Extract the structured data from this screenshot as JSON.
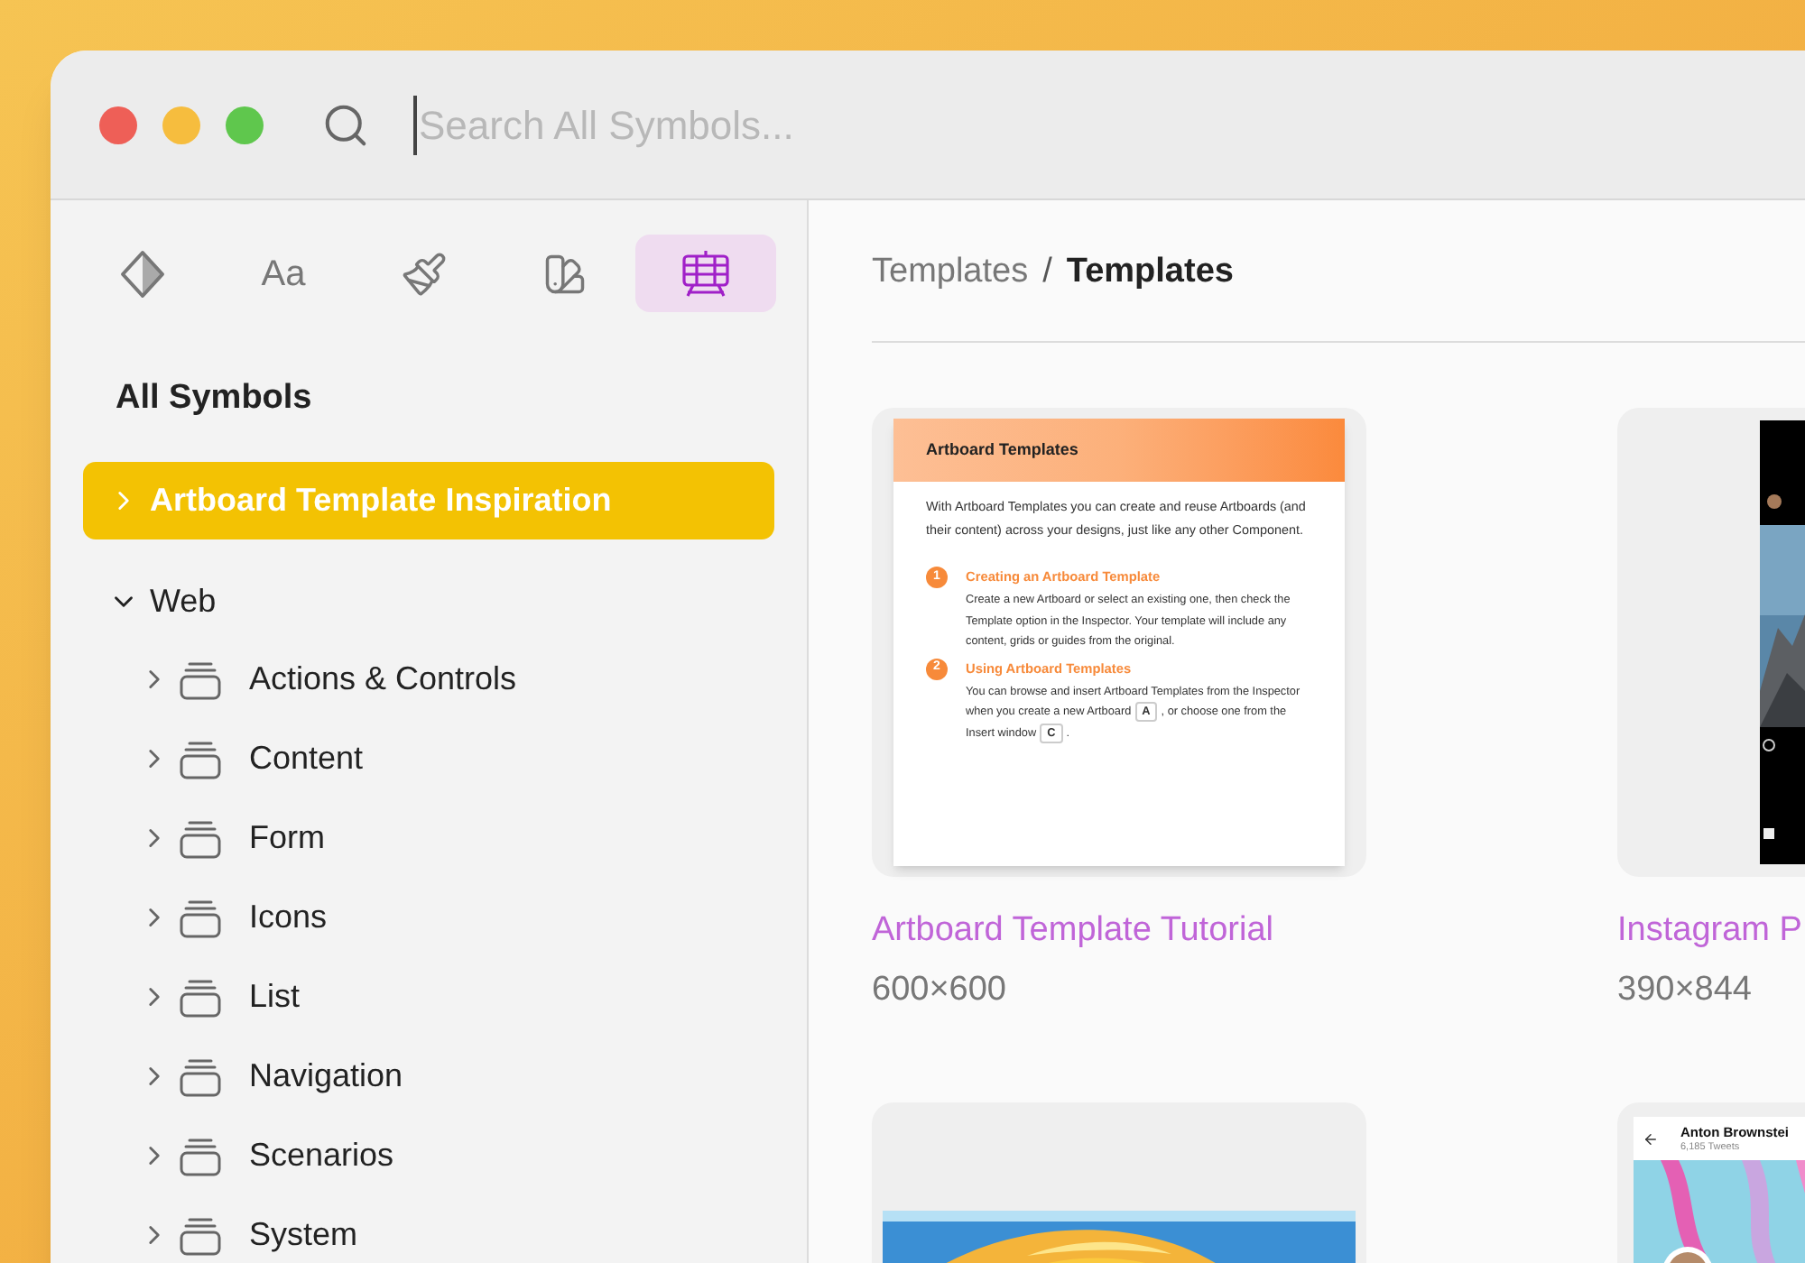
{
  "window": {
    "search": {
      "placeholder": "Search All Symbols..."
    }
  },
  "sidebar": {
    "tabs": [
      {
        "kind": "symbols",
        "selected": false
      },
      {
        "kind": "text",
        "label": "Aa",
        "selected": false
      },
      {
        "kind": "styles",
        "selected": false
      },
      {
        "kind": "colors",
        "selected": false
      },
      {
        "kind": "templates",
        "selected": true
      }
    ],
    "heading": "All Symbols",
    "items": [
      {
        "label": "Artboard Template Inspiration",
        "selected": true,
        "expanded": false
      },
      {
        "label": "Web",
        "selected": false,
        "expanded": true,
        "children": [
          {
            "label": "Actions & Controls",
            "selected": false,
            "expanded": false
          },
          {
            "label": "Content",
            "selected": false,
            "expanded": false
          },
          {
            "label": "Form",
            "selected": false,
            "expanded": false
          },
          {
            "label": "Icons",
            "selected": false,
            "expanded": false
          },
          {
            "label": "List",
            "selected": false,
            "expanded": false
          },
          {
            "label": "Navigation",
            "selected": false,
            "expanded": false
          },
          {
            "label": "Scenarios",
            "selected": false,
            "expanded": false
          },
          {
            "label": "System",
            "selected": false,
            "expanded": false
          }
        ]
      }
    ]
  },
  "breadcrumb": {
    "parent": "Templates",
    "separator": "/",
    "current": "Templates"
  },
  "templates": [
    {
      "kind": "tutorial",
      "title": "Artboard Template Tutorial",
      "size": "600×600",
      "preview": {
        "heading": "Artboard Templates",
        "intro": "With Artboard Templates you can create and reuse Artboards (and their content) across your designs, just like any other Component.",
        "steps": [
          {
            "number": "1",
            "title": "Creating an Artboard Template",
            "segments": [
              {
                "kind": "text",
                "text": "Create a new Artboard or select an existing one, then check the Template option in the Inspector. Your template will include any content, grids or guides from the original."
              }
            ]
          },
          {
            "number": "2",
            "title": "Using Artboard Templates",
            "segments": [
              {
                "kind": "text",
                "text": "You can browse and insert Artboard Templates from the Inspector when you create a new Artboard"
              },
              {
                "kind": "key",
                "text": "A"
              },
              {
                "kind": "text",
                "text": ", or choose one from the Insert window"
              },
              {
                "kind": "key",
                "text": "C"
              },
              {
                "kind": "text",
                "text": "."
              }
            ]
          }
        ]
      }
    },
    {
      "kind": "phone",
      "title": "Instagram P",
      "size": "390×844"
    },
    {
      "kind": "desktop"
    },
    {
      "kind": "profile",
      "preview": {
        "name": "Anton Brownstei",
        "subtitle": "6,185 Tweets"
      }
    }
  ]
}
